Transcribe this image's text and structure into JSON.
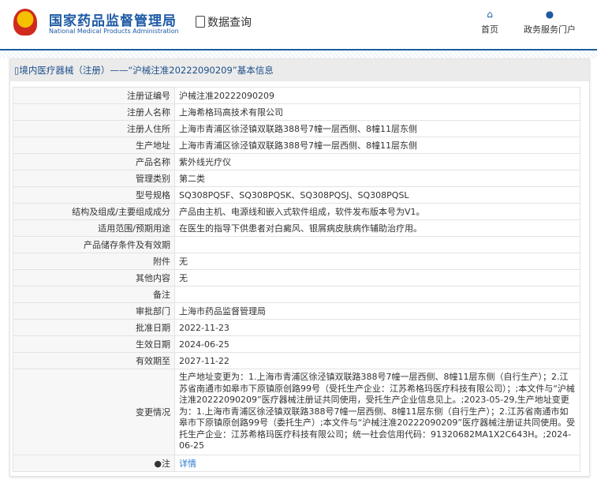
{
  "header": {
    "logo_cn": "国家药品监督管理局",
    "logo_en": "National Medical Products Administration",
    "section": "数据查询",
    "nav": [
      {
        "label": "首页",
        "icon": "home-icon"
      },
      {
        "label": "政务服务门户",
        "icon": "user-icon"
      }
    ]
  },
  "panel": {
    "title": "境内医疗器械（注册）——“沪械注准20222090209”基本信息"
  },
  "rows": [
    {
      "label": "注册证编号",
      "value": "沪械注准20222090209"
    },
    {
      "label": "注册人名称",
      "value": "上海希格玛高技术有限公司"
    },
    {
      "label": "注册人住所",
      "value": "上海市青浦区徐泾镇双联路388号7幢一层西侧、8幢11层东侧"
    },
    {
      "label": "生产地址",
      "value": "上海市青浦区徐泾镇双联路388号7幢一层西侧、8幢11层东侧"
    },
    {
      "label": "产品名称",
      "value": "紫外线光疗仪"
    },
    {
      "label": "管理类别",
      "value": "第二类"
    },
    {
      "label": "型号规格",
      "value": "SQ308PQSF、SQ308PQSK、SQ308PQSJ、SQ308PQSL"
    },
    {
      "label": "结构及组成/主要组成成分",
      "value": "产品由主机、电源线和嵌入式软件组成，软件发布版本号为V1。"
    },
    {
      "label": "适用范围/预期用途",
      "value": "在医生的指导下供患者对白癜风、银屑病皮肤病作辅助治疗用。"
    },
    {
      "label": "产品储存条件及有效期",
      "value": ""
    },
    {
      "label": "附件",
      "value": "无"
    },
    {
      "label": "其他内容",
      "value": "无"
    },
    {
      "label": "备注",
      "value": ""
    },
    {
      "label": "审批部门",
      "value": "上海市药品监督管理局"
    },
    {
      "label": "批准日期",
      "value": "2022-11-23"
    },
    {
      "label": "生效日期",
      "value": "2024-06-25"
    },
    {
      "label": "有效期至",
      "value": "2027-11-22"
    },
    {
      "label": "变更情况",
      "value": "生产地址变更为：1.上海市青浦区徐泾镇双联路388号7幢一层西侧、8幢11层东侧（自行生产）；2.江苏省南通市如皋市下原镇原创路99号（受托生产企业：江苏希格玛医疗科技有限公司）；;本文件与“沪械注准20222090209”医疗器械注册证共同使用，受托生产企业信息见上。;2023-05-29,生产地址变更为：1.上海市青浦区徐泾镇双联路388号7幢一层西侧、8幢11层东侧（自行生产）；2.江苏省南通市如皋市下原镇原创路99号（委托生产）;本文件与“沪械注准20222090209”医疗器械注册证共同使用。受托生产企业：江苏希格玛医疗科技有限公司；统一社会信用代码：91320682MA1X2C643H。;2024-06-25"
    }
  ],
  "note": {
    "label": "注",
    "link": "详情"
  }
}
